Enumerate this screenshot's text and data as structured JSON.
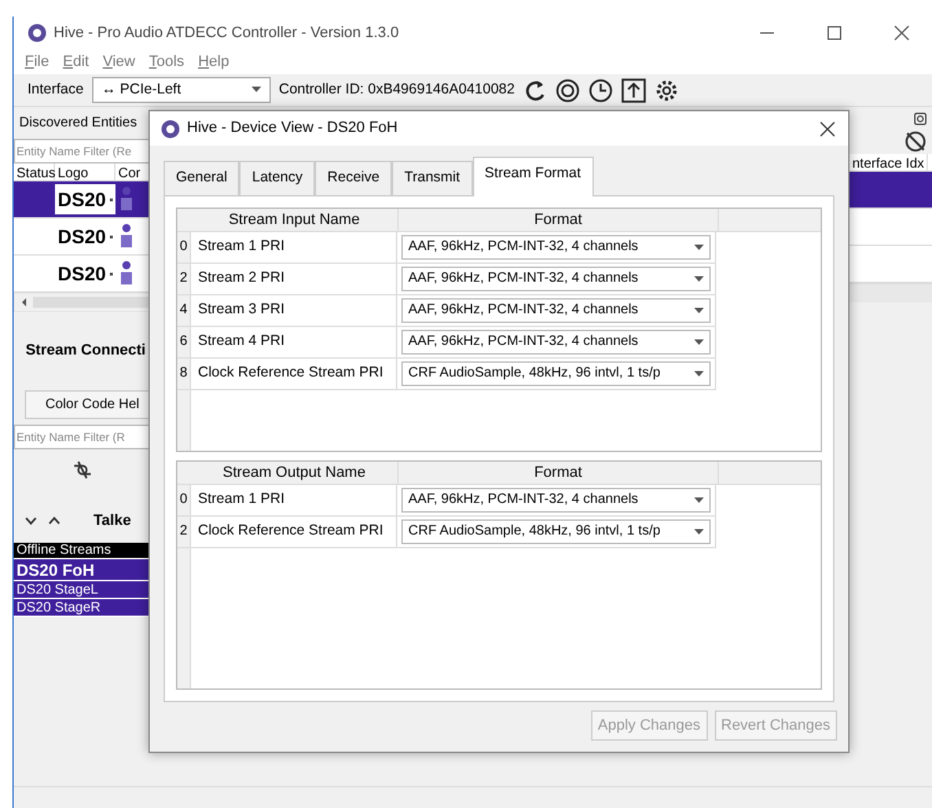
{
  "window": {
    "title": "Hive - Pro Audio ATDECC Controller - Version 1.3.0"
  },
  "menu": [
    "File",
    "Edit",
    "View",
    "Tools",
    "Help"
  ],
  "toolbar": {
    "interface_label": "Interface",
    "interface_value": "↔ PCIe-Left",
    "controller_id": "Controller ID: 0xB4969146A0410082"
  },
  "discovered": {
    "title": "Discovered Entities",
    "filter_placeholder": "Entity Name Filter (Re",
    "columns": [
      "Status",
      "Logo",
      "Cor"
    ],
    "right_column": "nterface Idx",
    "rows": [
      {
        "logo": "DS20",
        "selected": true
      },
      {
        "logo": "DS20",
        "selected": false
      },
      {
        "logo": "DS20",
        "selected": false
      }
    ]
  },
  "connections": {
    "title": "Stream Connecti",
    "color_button": "Color Code Hel",
    "filter_placeholder": "Entity Name Filter (R",
    "talker_label": "Talke",
    "streams": [
      {
        "label": "Offline Streams",
        "kind": "header"
      },
      {
        "label": "DS20 FoH",
        "kind": "entity"
      },
      {
        "label": "DS20 StageL",
        "kind": "stream"
      },
      {
        "label": "DS20 StageR",
        "kind": "stream"
      }
    ]
  },
  "dialog": {
    "title": "Hive - Device View - DS20 FoH",
    "tabs": [
      {
        "label": "General",
        "selected": false
      },
      {
        "label": "Latency",
        "selected": false
      },
      {
        "label": "Receive",
        "selected": false
      },
      {
        "label": "Transmit",
        "selected": false
      },
      {
        "label": "Stream Format",
        "selected": true
      }
    ],
    "inputs": {
      "columns": [
        "Stream Input Name",
        "Format"
      ],
      "rows": [
        {
          "index": "0",
          "name": "Stream 1 PRI",
          "format": "AAF, 96kHz, PCM-INT-32, 4 channels"
        },
        {
          "index": "2",
          "name": "Stream 2 PRI",
          "format": "AAF, 96kHz, PCM-INT-32, 4 channels"
        },
        {
          "index": "4",
          "name": "Stream 3 PRI",
          "format": "AAF, 96kHz, PCM-INT-32, 4 channels"
        },
        {
          "index": "6",
          "name": "Stream 4 PRI",
          "format": "AAF, 96kHz, PCM-INT-32, 4 channels"
        },
        {
          "index": "8",
          "name": "Clock Reference Stream PRI",
          "format": "CRF AudioSample, 48kHz, 96 intvl, 1 ts/p"
        }
      ]
    },
    "outputs": {
      "columns": [
        "Stream Output Name",
        "Format"
      ],
      "rows": [
        {
          "index": "0",
          "name": "Stream 1 PRI",
          "format": "AAF, 96kHz, PCM-INT-32, 4 channels"
        },
        {
          "index": "2",
          "name": "Clock Reference Stream PRI",
          "format": "CRF AudioSample, 48kHz, 96 intvl, 1 ts/p"
        }
      ]
    },
    "buttons": [
      {
        "label": "Apply Changes",
        "disabled": true
      },
      {
        "label": "Revert Changes",
        "disabled": true
      }
    ]
  }
}
